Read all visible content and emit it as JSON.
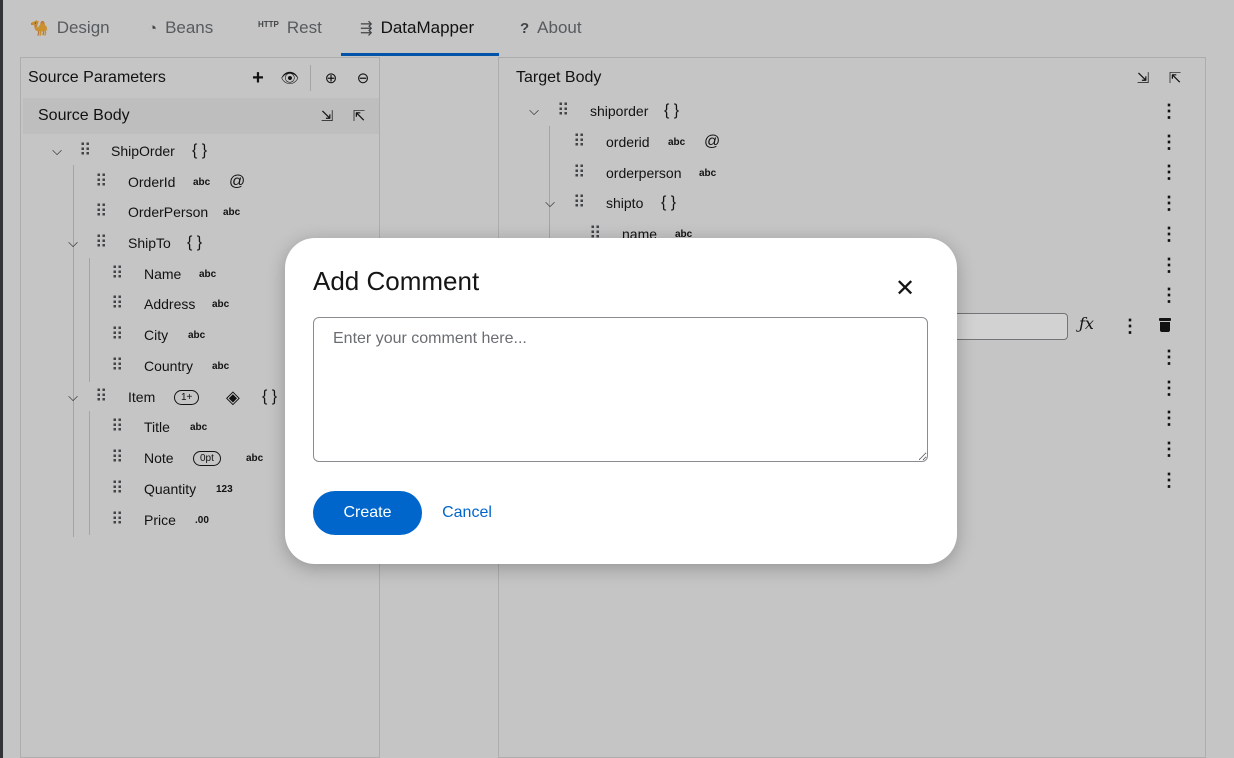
{
  "tabs": [
    {
      "label": "Design",
      "icon": "camel-icon"
    },
    {
      "label": "Beans",
      "icon": "bean-icon"
    },
    {
      "label": "Rest",
      "icon": "http-icon",
      "icon_text": "HTTP"
    },
    {
      "label": "DataMapper",
      "icon": "datamapper-icon",
      "active": true
    },
    {
      "label": "About",
      "icon": "question-icon"
    }
  ],
  "source": {
    "title": "Source Parameters",
    "body_title": "Source Body",
    "tree": [
      {
        "label": "ShipOrder",
        "glyph": "{ }"
      },
      {
        "label": "OrderId",
        "type": "abc",
        "glyph": "@"
      },
      {
        "label": "OrderPerson",
        "type": "abc"
      },
      {
        "label": "ShipTo",
        "glyph": "{ }"
      },
      {
        "label": "Name",
        "type": "abc"
      },
      {
        "label": "Address",
        "type": "abc"
      },
      {
        "label": "City",
        "type": "abc"
      },
      {
        "label": "Country",
        "type": "abc"
      },
      {
        "label": "Item",
        "badge": "1+",
        "glyph": "{ }"
      },
      {
        "label": "Title",
        "type": "abc"
      },
      {
        "label": "Note",
        "badge": "0pt",
        "type": "abc"
      },
      {
        "label": "Quantity",
        "type": "123"
      },
      {
        "label": "Price",
        "type": ".00"
      }
    ]
  },
  "target": {
    "title": "Target Body",
    "tree": [
      {
        "label": "shiporder",
        "glyph": "{ }"
      },
      {
        "label": "orderid",
        "type": "abc",
        "glyph": "@"
      },
      {
        "label": "orderperson",
        "type": "abc"
      },
      {
        "label": "shipto",
        "glyph": "{ }"
      },
      {
        "label": "name",
        "type": "abc"
      }
    ],
    "fx_label": "ƒx"
  },
  "modal": {
    "title": "Add Comment",
    "placeholder": "Enter your comment here...",
    "create_label": "Create",
    "cancel_label": "Cancel",
    "close_glyph": "✕"
  },
  "colors": {
    "primary": "#0066cc",
    "tab_active_underline": "#0066cc"
  }
}
